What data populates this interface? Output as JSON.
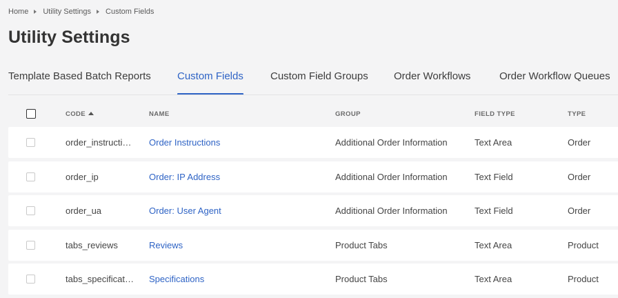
{
  "breadcrumb": [
    {
      "label": "Home"
    },
    {
      "label": "Utility Settings"
    },
    {
      "label": "Custom Fields"
    }
  ],
  "page_title": "Utility Settings",
  "tabs": [
    {
      "label": "Template Based Batch Reports",
      "active": false
    },
    {
      "label": "Custom Fields",
      "active": true
    },
    {
      "label": "Custom Field Groups",
      "active": false
    },
    {
      "label": "Order Workflows",
      "active": false
    },
    {
      "label": "Order Workflow Queues",
      "active": false
    }
  ],
  "table": {
    "columns": {
      "code": "CODE",
      "name": "NAME",
      "group": "GROUP",
      "field_type": "FIELD TYPE",
      "type": "TYPE"
    },
    "sort": {
      "column": "code",
      "direction": "ascending",
      "icon": "sort-up-icon"
    },
    "rows": [
      {
        "code": "order_instructions",
        "name": "Order Instructions",
        "group": "Additional Order Information",
        "field_type": "Text Area",
        "type": "Order"
      },
      {
        "code": "order_ip",
        "name": "Order: IP Address",
        "group": "Additional Order Information",
        "field_type": "Text Field",
        "type": "Order"
      },
      {
        "code": "order_ua",
        "name": "Order: User Agent",
        "group": "Additional Order Information",
        "field_type": "Text Field",
        "type": "Order"
      },
      {
        "code": "tabs_reviews",
        "name": "Reviews",
        "group": "Product Tabs",
        "field_type": "Text Area",
        "type": "Product"
      },
      {
        "code": "tabs_specifications",
        "name": "Specifications",
        "group": "Product Tabs",
        "field_type": "Text Area",
        "type": "Product"
      }
    ]
  },
  "colors": {
    "accent": "#2e63c5",
    "background": "#f4f4f5",
    "row_background": "#ffffff"
  }
}
